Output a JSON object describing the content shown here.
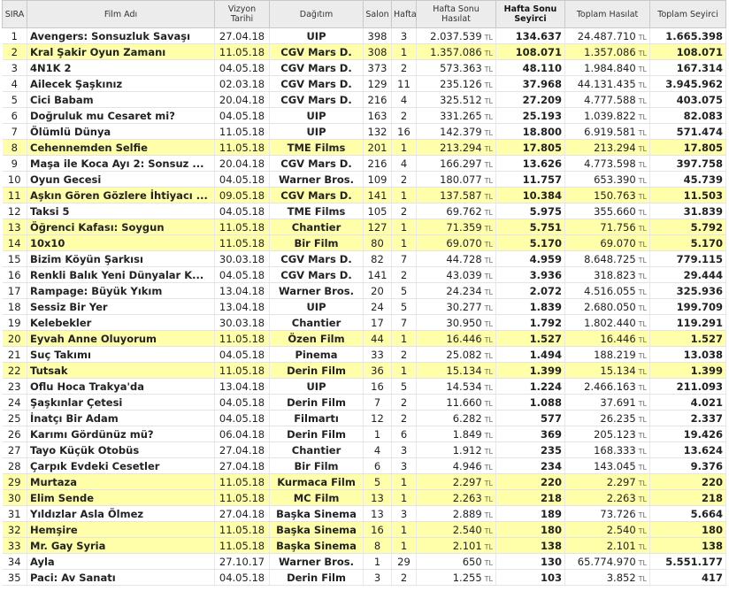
{
  "headers": {
    "rank": "SIRA",
    "title": "Film Adı",
    "release": "Vizyon Tarihi",
    "distributor": "Dağıtım",
    "screens": "Salon",
    "week": "Hafta",
    "weekend_gross": "Hafta Sonu Hasılat",
    "weekend_admissions": "Hafta Sonu Seyirci",
    "total_gross": "Toplam Hasılat",
    "total_admissions": "Toplam Seyirci"
  },
  "currency": "TL",
  "rows": [
    {
      "rank": "1",
      "title": "Avengers: Sonsuzluk Savaşı",
      "release": "27.04.18",
      "distributor": "UIP",
      "screens": "398",
      "week": "3",
      "weekend_gross": "2.037.539",
      "weekend_admissions": "134.637",
      "total_gross": "24.487.710",
      "total_admissions": "1.665.398",
      "highlight": false
    },
    {
      "rank": "2",
      "title": "Kral Şakir Oyun Zamanı",
      "release": "11.05.18",
      "distributor": "CGV Mars D.",
      "screens": "308",
      "week": "1",
      "weekend_gross": "1.357.086",
      "weekend_admissions": "108.071",
      "total_gross": "1.357.086",
      "total_admissions": "108.071",
      "highlight": true
    },
    {
      "rank": "3",
      "title": "4N1K 2",
      "release": "04.05.18",
      "distributor": "CGV Mars D.",
      "screens": "373",
      "week": "2",
      "weekend_gross": "573.363",
      "weekend_admissions": "48.110",
      "total_gross": "1.984.840",
      "total_admissions": "167.314",
      "highlight": false
    },
    {
      "rank": "4",
      "title": "Ailecek Şaşkınız",
      "release": "02.03.18",
      "distributor": "CGV Mars D.",
      "screens": "129",
      "week": "11",
      "weekend_gross": "235.126",
      "weekend_admissions": "37.968",
      "total_gross": "44.131.435",
      "total_admissions": "3.945.962",
      "highlight": false
    },
    {
      "rank": "5",
      "title": "Cici Babam",
      "release": "20.04.18",
      "distributor": "CGV Mars D.",
      "screens": "216",
      "week": "4",
      "weekend_gross": "325.512",
      "weekend_admissions": "27.209",
      "total_gross": "4.777.588",
      "total_admissions": "403.075",
      "highlight": false
    },
    {
      "rank": "6",
      "title": "Doğruluk mu Cesaret mi?",
      "release": "04.05.18",
      "distributor": "UIP",
      "screens": "163",
      "week": "2",
      "weekend_gross": "331.265",
      "weekend_admissions": "25.193",
      "total_gross": "1.039.822",
      "total_admissions": "82.083",
      "highlight": false
    },
    {
      "rank": "7",
      "title": "Ölümlü Dünya",
      "release": "11.05.18",
      "distributor": "UIP",
      "screens": "132",
      "week": "16",
      "weekend_gross": "142.379",
      "weekend_admissions": "18.800",
      "total_gross": "6.919.581",
      "total_admissions": "571.474",
      "highlight": false
    },
    {
      "rank": "8",
      "title": "Cehennemden Selfie",
      "release": "11.05.18",
      "distributor": "TME Films",
      "screens": "201",
      "week": "1",
      "weekend_gross": "213.294",
      "weekend_admissions": "17.805",
      "total_gross": "213.294",
      "total_admissions": "17.805",
      "highlight": true
    },
    {
      "rank": "9",
      "title": "Maşa ile Koca Ayı 2: Sonsuz ...",
      "release": "20.04.18",
      "distributor": "CGV Mars D.",
      "screens": "216",
      "week": "4",
      "weekend_gross": "166.297",
      "weekend_admissions": "13.626",
      "total_gross": "4.773.598",
      "total_admissions": "397.758",
      "highlight": false
    },
    {
      "rank": "10",
      "title": "Oyun Gecesi",
      "release": "04.05.18",
      "distributor": "Warner Bros.",
      "screens": "109",
      "week": "2",
      "weekend_gross": "180.077",
      "weekend_admissions": "11.757",
      "total_gross": "653.390",
      "total_admissions": "45.739",
      "highlight": false
    },
    {
      "rank": "11",
      "title": "Aşkın Gören Gözlere İhtiyacı ...",
      "release": "09.05.18",
      "distributor": "CGV Mars D.",
      "screens": "141",
      "week": "1",
      "weekend_gross": "137.587",
      "weekend_admissions": "10.384",
      "total_gross": "150.763",
      "total_admissions": "11.503",
      "highlight": true
    },
    {
      "rank": "12",
      "title": "Taksi 5",
      "release": "04.05.18",
      "distributor": "TME Films",
      "screens": "105",
      "week": "2",
      "weekend_gross": "69.762",
      "weekend_admissions": "5.975",
      "total_gross": "355.660",
      "total_admissions": "31.839",
      "highlight": false
    },
    {
      "rank": "13",
      "title": "Öğrenci Kafası: Soygun",
      "release": "11.05.18",
      "distributor": "Chantier",
      "screens": "127",
      "week": "1",
      "weekend_gross": "71.359",
      "weekend_admissions": "5.751",
      "total_gross": "71.756",
      "total_admissions": "5.792",
      "highlight": true
    },
    {
      "rank": "14",
      "title": "10x10",
      "release": "11.05.18",
      "distributor": "Bir Film",
      "screens": "80",
      "week": "1",
      "weekend_gross": "69.070",
      "weekend_admissions": "5.170",
      "total_gross": "69.070",
      "total_admissions": "5.170",
      "highlight": true
    },
    {
      "rank": "15",
      "title": "Bizim Köyün Şarkısı",
      "release": "30.03.18",
      "distributor": "CGV Mars D.",
      "screens": "82",
      "week": "7",
      "weekend_gross": "44.728",
      "weekend_admissions": "4.959",
      "total_gross": "8.648.725",
      "total_admissions": "779.115",
      "highlight": false
    },
    {
      "rank": "16",
      "title": "Renkli Balık Yeni Dünyalar K...",
      "release": "04.05.18",
      "distributor": "CGV Mars D.",
      "screens": "141",
      "week": "2",
      "weekend_gross": "43.039",
      "weekend_admissions": "3.936",
      "total_gross": "318.823",
      "total_admissions": "29.444",
      "highlight": false
    },
    {
      "rank": "17",
      "title": "Rampage: Büyük Yıkım",
      "release": "13.04.18",
      "distributor": "Warner Bros.",
      "screens": "20",
      "week": "5",
      "weekend_gross": "24.234",
      "weekend_admissions": "2.072",
      "total_gross": "4.516.055",
      "total_admissions": "325.936",
      "highlight": false
    },
    {
      "rank": "18",
      "title": "Sessiz Bir Yer",
      "release": "13.04.18",
      "distributor": "UIP",
      "screens": "24",
      "week": "5",
      "weekend_gross": "30.277",
      "weekend_admissions": "1.839",
      "total_gross": "2.680.050",
      "total_admissions": "199.709",
      "highlight": false
    },
    {
      "rank": "19",
      "title": "Kelebekler",
      "release": "30.03.18",
      "distributor": "Chantier",
      "screens": "17",
      "week": "7",
      "weekend_gross": "30.950",
      "weekend_admissions": "1.792",
      "total_gross": "1.802.440",
      "total_admissions": "119.291",
      "highlight": false
    },
    {
      "rank": "20",
      "title": "Eyvah Anne Oluyorum",
      "release": "11.05.18",
      "distributor": "Özen Film",
      "screens": "44",
      "week": "1",
      "weekend_gross": "16.446",
      "weekend_admissions": "1.527",
      "total_gross": "16.446",
      "total_admissions": "1.527",
      "highlight": true
    },
    {
      "rank": "21",
      "title": "Suç Takımı",
      "release": "04.05.18",
      "distributor": "Pinema",
      "screens": "33",
      "week": "2",
      "weekend_gross": "25.082",
      "weekend_admissions": "1.494",
      "total_gross": "188.219",
      "total_admissions": "13.038",
      "highlight": false
    },
    {
      "rank": "22",
      "title": "Tutsak",
      "release": "11.05.18",
      "distributor": "Derin Film",
      "screens": "36",
      "week": "1",
      "weekend_gross": "15.134",
      "weekend_admissions": "1.399",
      "total_gross": "15.134",
      "total_admissions": "1.399",
      "highlight": true
    },
    {
      "rank": "23",
      "title": "Oflu Hoca Trakya'da",
      "release": "13.04.18",
      "distributor": "UIP",
      "screens": "16",
      "week": "5",
      "weekend_gross": "14.534",
      "weekend_admissions": "1.224",
      "total_gross": "2.466.163",
      "total_admissions": "211.093",
      "highlight": false
    },
    {
      "rank": "24",
      "title": "Şaşkınlar Çetesi",
      "release": "04.05.18",
      "distributor": "Derin Film",
      "screens": "7",
      "week": "2",
      "weekend_gross": "11.660",
      "weekend_admissions": "1.088",
      "total_gross": "37.691",
      "total_admissions": "4.021",
      "highlight": false
    },
    {
      "rank": "25",
      "title": "İnatçı Bir Adam",
      "release": "04.05.18",
      "distributor": "Filmartı",
      "screens": "12",
      "week": "2",
      "weekend_gross": "6.282",
      "weekend_admissions": "577",
      "total_gross": "26.235",
      "total_admissions": "2.337",
      "highlight": false
    },
    {
      "rank": "26",
      "title": "Karımı Gördünüz mü?",
      "release": "06.04.18",
      "distributor": "Derin Film",
      "screens": "1",
      "week": "6",
      "weekend_gross": "1.849",
      "weekend_admissions": "369",
      "total_gross": "205.123",
      "total_admissions": "19.426",
      "highlight": false
    },
    {
      "rank": "27",
      "title": "Tayo Küçük Otobüs",
      "release": "27.04.18",
      "distributor": "Chantier",
      "screens": "4",
      "week": "3",
      "weekend_gross": "1.912",
      "weekend_admissions": "235",
      "total_gross": "168.333",
      "total_admissions": "13.624",
      "highlight": false
    },
    {
      "rank": "28",
      "title": "Çarpık Evdeki Cesetler",
      "release": "27.04.18",
      "distributor": "Bir Film",
      "screens": "6",
      "week": "3",
      "weekend_gross": "4.946",
      "weekend_admissions": "234",
      "total_gross": "143.045",
      "total_admissions": "9.376",
      "highlight": false
    },
    {
      "rank": "29",
      "title": "Murtaza",
      "release": "11.05.18",
      "distributor": "Kurmaca Film",
      "screens": "5",
      "week": "1",
      "weekend_gross": "2.297",
      "weekend_admissions": "220",
      "total_gross": "2.297",
      "total_admissions": "220",
      "highlight": true
    },
    {
      "rank": "30",
      "title": "Elim Sende",
      "release": "11.05.18",
      "distributor": "MC Film",
      "screens": "13",
      "week": "1",
      "weekend_gross": "2.263",
      "weekend_admissions": "218",
      "total_gross": "2.263",
      "total_admissions": "218",
      "highlight": true
    },
    {
      "rank": "31",
      "title": "Yıldızlar Asla Ölmez",
      "release": "27.04.18",
      "distributor": "Başka Sinema",
      "screens": "13",
      "week": "3",
      "weekend_gross": "2.889",
      "weekend_admissions": "189",
      "total_gross": "73.726",
      "total_admissions": "5.664",
      "highlight": false
    },
    {
      "rank": "32",
      "title": "Hemşire",
      "release": "11.05.18",
      "distributor": "Başka Sinema",
      "screens": "16",
      "week": "1",
      "weekend_gross": "2.540",
      "weekend_admissions": "180",
      "total_gross": "2.540",
      "total_admissions": "180",
      "highlight": true
    },
    {
      "rank": "33",
      "title": "Mr. Gay Syria",
      "release": "11.05.18",
      "distributor": "Başka Sinema",
      "screens": "8",
      "week": "1",
      "weekend_gross": "2.101",
      "weekend_admissions": "138",
      "total_gross": "2.101",
      "total_admissions": "138",
      "highlight": true
    },
    {
      "rank": "34",
      "title": "Ayla",
      "release": "27.10.17",
      "distributor": "Warner Bros.",
      "screens": "1",
      "week": "29",
      "weekend_gross": "650",
      "weekend_admissions": "130",
      "total_gross": "65.774.970",
      "total_admissions": "5.551.177",
      "highlight": false
    },
    {
      "rank": "35",
      "title": "Paci: Av Sanatı",
      "release": "04.05.18",
      "distributor": "Derin Film",
      "screens": "3",
      "week": "2",
      "weekend_gross": "1.255",
      "weekend_admissions": "103",
      "total_gross": "3.852",
      "total_admissions": "417",
      "highlight": false
    }
  ]
}
